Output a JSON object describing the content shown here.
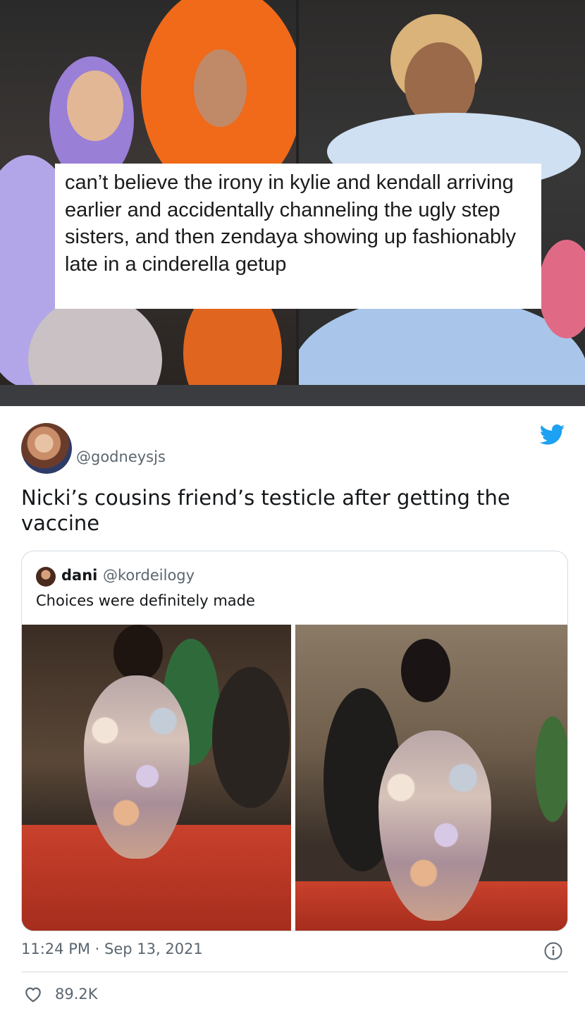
{
  "meme": {
    "caption": "can’t believe the irony in kylie and kendall arriving earlier and accidentally channeling the ugly step sisters, and then zendaya showing up fashionably late in a cinderella getup"
  },
  "tweet": {
    "handle": "@godneysjs",
    "text": "Nicki’s cousins friend’s testicle after getting the vaccine",
    "timestamp": "11:24 PM · Sep 13, 2021",
    "likes": "89.2K",
    "quote": {
      "name": "dani",
      "handle": "@kordeilogy",
      "text": "Choices were definitely made"
    }
  },
  "colors": {
    "twitter_blue": "#1da1f2",
    "secondary_text": "#5b6670",
    "border": "#d4dbe1"
  },
  "icons": [
    "twitter-bird-icon",
    "info-icon",
    "heart-icon"
  ]
}
